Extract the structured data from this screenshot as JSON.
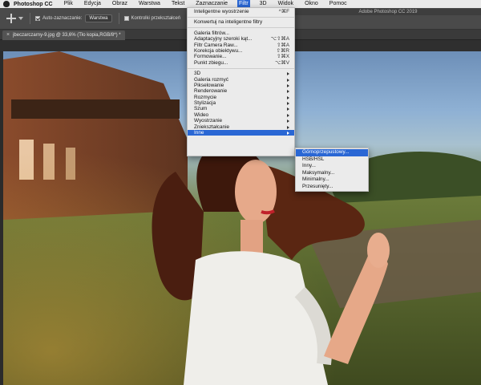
{
  "menubar": {
    "app_name": "Photoshop CC",
    "items": [
      {
        "label": "Plik"
      },
      {
        "label": "Edycja"
      },
      {
        "label": "Obraz"
      },
      {
        "label": "Warstwa"
      },
      {
        "label": "Tekst"
      },
      {
        "label": "Zaznaczanie"
      },
      {
        "label": "Filtr",
        "active": true
      },
      {
        "label": "3D"
      },
      {
        "label": "Widok"
      },
      {
        "label": "Okno"
      },
      {
        "label": "Pomoc"
      }
    ]
  },
  "options_bar": {
    "auto_select_label": "Auto-zaznaczanie:",
    "auto_select_checked": true,
    "auto_select_target": "Warstwa",
    "transform_controls_label": "Kontrolki przekształceń",
    "transform_controls_checked": false
  },
  "window_title": "Adobe Photoshop CC 2019",
  "document_tab": {
    "title": "jbeczarczarny-9.jpg @ 33,6% (Tło kopia,RGB/8*) *"
  },
  "filter_menu": {
    "items": [
      {
        "label": "Inteligentne wyostrzenie",
        "shortcut": "^⌘F"
      },
      {
        "divider": true
      },
      {
        "label": "Konwertuj na inteligentne filtry"
      },
      {
        "divider": true
      },
      {
        "label": "Galeria filtrów..."
      },
      {
        "label": "Adaptacyjny szeroki kąt...",
        "shortcut": "⌥⇧⌘A"
      },
      {
        "label": "Filtr Camera Raw...",
        "shortcut": "⇧⌘A"
      },
      {
        "label": "Korekcja obiektywu...",
        "shortcut": "⇧⌘R"
      },
      {
        "label": "Formowanie...",
        "shortcut": "⇧⌘X"
      },
      {
        "label": "Punkt zbiegu...",
        "shortcut": "⌥⌘V"
      },
      {
        "divider": true
      },
      {
        "label": "3D",
        "submenu": true
      },
      {
        "label": "Galeria rozmyć",
        "submenu": true
      },
      {
        "label": "Pikselowanie",
        "submenu": true
      },
      {
        "label": "Renderowanie",
        "submenu": true
      },
      {
        "label": "Rozmycie",
        "submenu": true
      },
      {
        "label": "Stylizacja",
        "submenu": true
      },
      {
        "label": "Szum",
        "submenu": true
      },
      {
        "label": "Wideo",
        "submenu": true
      },
      {
        "label": "Wyostrzanie",
        "submenu": true
      },
      {
        "label": "Zniekształcanie",
        "submenu": true
      },
      {
        "label": "Inne",
        "submenu": true,
        "highlighted": true
      }
    ]
  },
  "other_submenu": {
    "items": [
      {
        "label": "Górnoprzepustowy...",
        "highlighted": true
      },
      {
        "label": "HSB/HSL"
      },
      {
        "label": "Inny..."
      },
      {
        "label": "Maksymalny..."
      },
      {
        "label": "Minimalny..."
      },
      {
        "label": "Przesunięty..."
      }
    ]
  },
  "colors": {
    "menu_highlight": "#2a67d4",
    "menu_background": "#ebebeb",
    "options_bar": "#4a4a4a"
  }
}
